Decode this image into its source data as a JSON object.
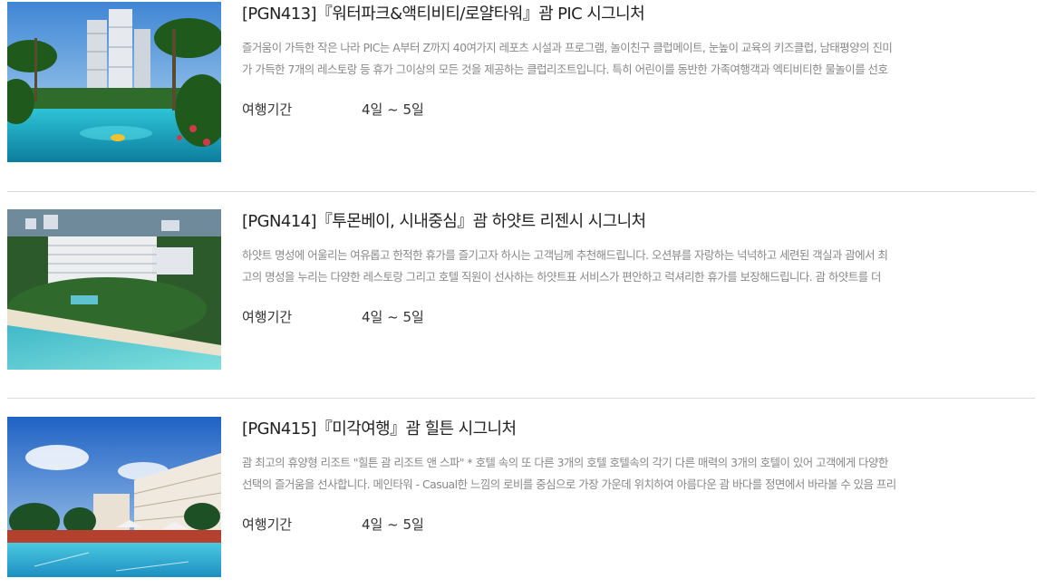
{
  "products": [
    {
      "title": "[PGN413]『워터파크&액티비티/로얄타워』괌 PIC 시그니처",
      "desc_lines": [
        "즐거움이 가득한 작은 나라 PIC는 A부터 Z까지 40여가지 레포츠 시설과 프로그램, 놀이친구 클럽메이트, 눈높이 교육의 키즈클럽, 남태평양의 진미",
        "가 가득한 7개의 레스토랑 등 휴가 그이상의 모든 것을 제공하는 클럽리조트입니다. 특히 어린이를 동반한 가족여행객과 엑티비티한 물놀이를 선호"
      ],
      "period_label": "여행기간",
      "period_value": "4일 ~ 5일"
    },
    {
      "title": "[PGN414]『투몬베이, 시내중심』괌 하얏트 리젠시 시그니처",
      "desc_lines": [
        "하얏트 명성에 어울리는 여유롭고 한적한 휴가를 즐기고자 하시는 고객님께 추천해드립니다. 오션뷰를 자랑하는 넉넉하고 세련된 객실과 괌에서 최",
        "고의 명성을 누리는 다양한 레스토랑 그리고 호텔 직원이 선사하는 하얏트표 서비스가 편안하고 럭셔리한 휴가를 보장해드립니다. 괌 하얏트를 더"
      ],
      "period_label": "여행기간",
      "period_value": "4일 ~ 5일"
    },
    {
      "title": "[PGN415]『미각여행』괌 힐튼 시그니처",
      "desc_lines": [
        "괌 최고의 휴양형 리조트 \"힐튼 괌 리조트 앤 스파\" * 호텔 속의 또 다른 3개의 호텔 호텔속의 각기 다른 매력의 3개의 호텔이 있어 고객에게 다양한",
        "선택의 즐거움을 선사합니다. 메인타워 - Casual한 느낌의 로비를 중심으로 가장 가운데 위치하여 아름다운 괌 바다를 정면에서 바라볼 수 있음 프리"
      ],
      "period_label": "여행기간",
      "period_value": "4일 ~ 5일"
    }
  ]
}
